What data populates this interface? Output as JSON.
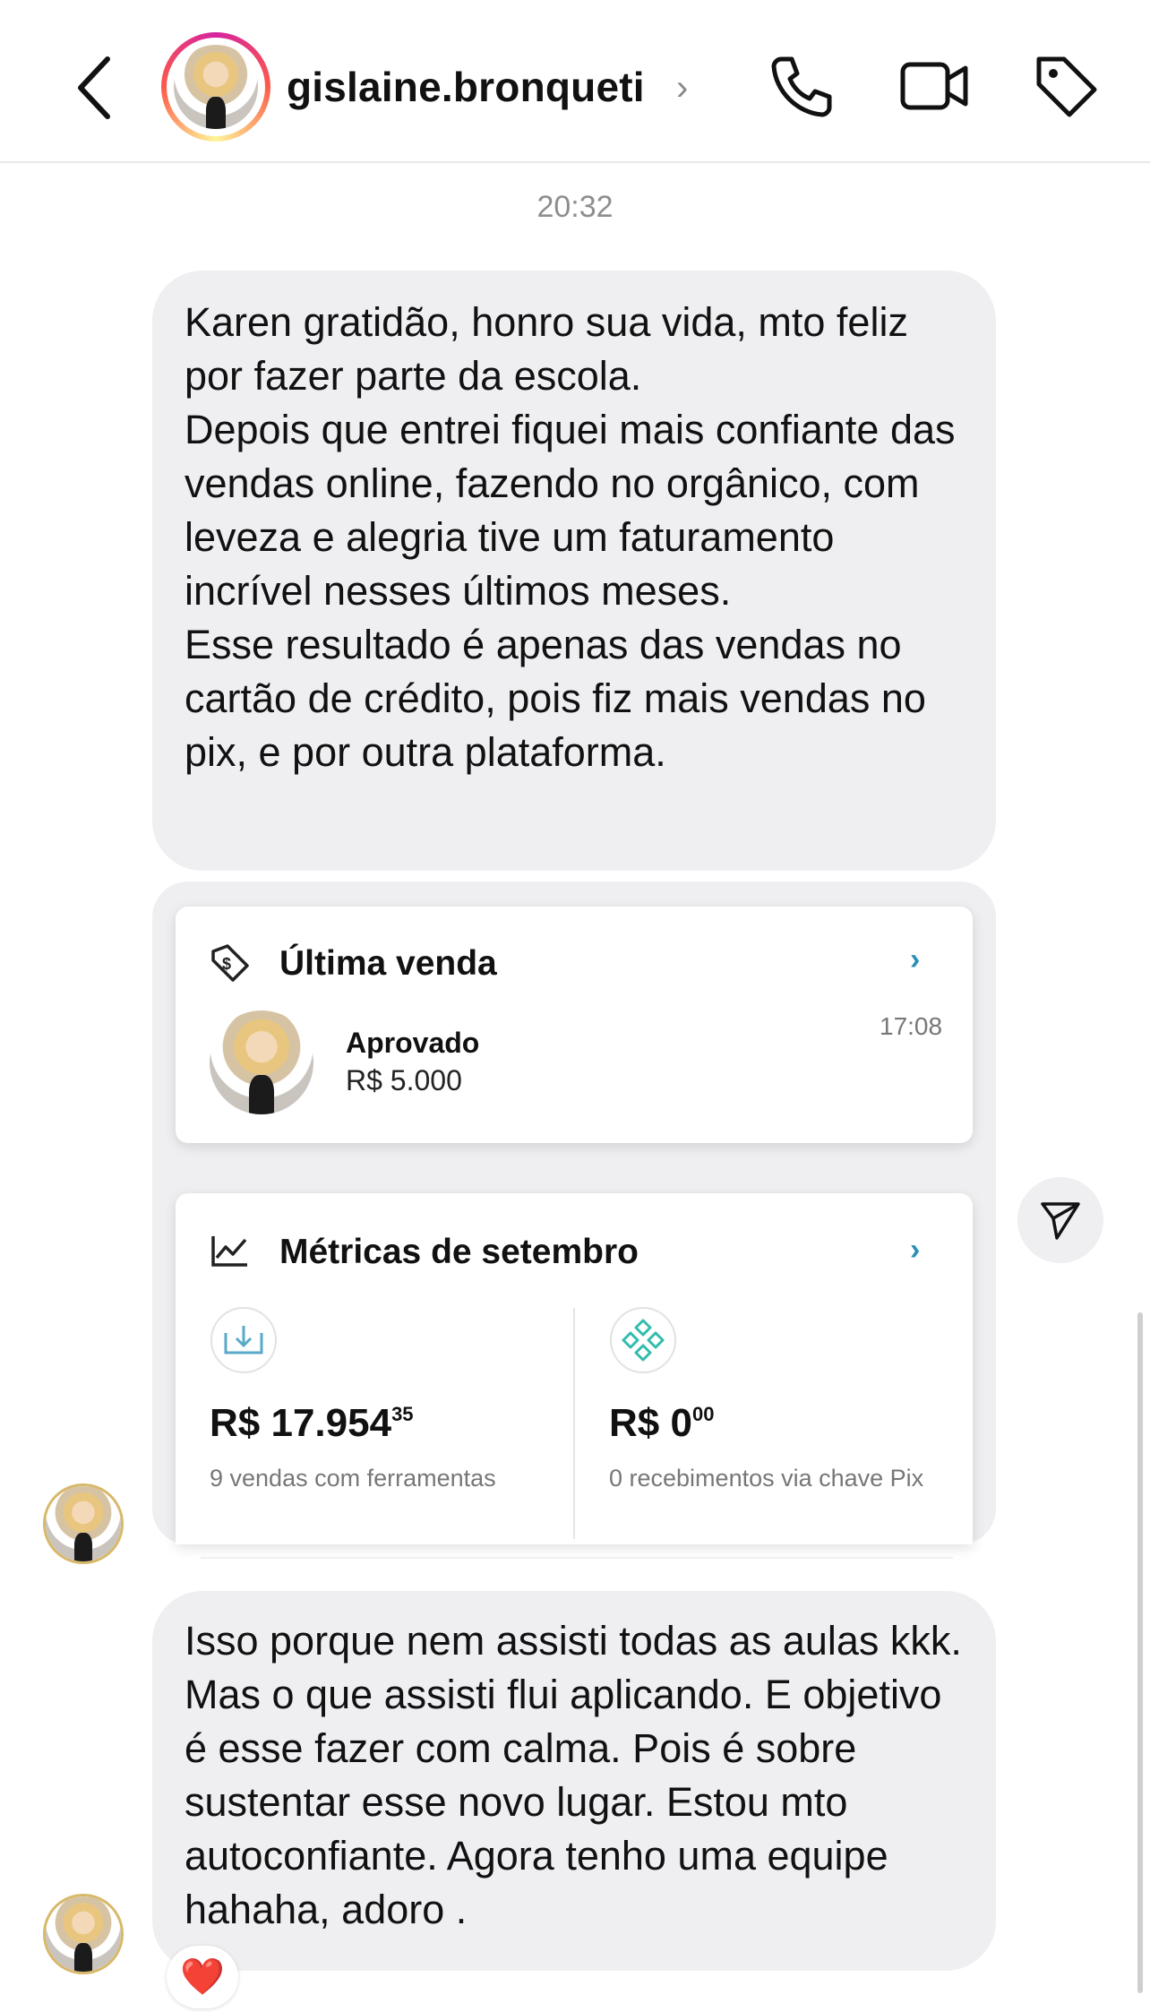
{
  "header": {
    "username": "gislaine.bronqueti",
    "chevron": "›"
  },
  "messages": {
    "timestamp": "20:32",
    "first": [
      "Karen gratidão, honro sua vida, mto feliz por fazer parte da escola.",
      "Depois que entrei fiquei mais confiante das vendas online, fazendo no orgânico, com leveza e alegria tive um faturamento incrível nesses últimos meses.",
      "Esse resultado é apenas das vendas no cartão de crédito, pois fiz mais vendas no pix, e por outra plataforma."
    ],
    "last": "Isso porque nem assisti todas as aulas kkk. Mas o que assisti flui aplicando. E objetivo é esse fazer com calma. Pois é sobre sustentar esse novo lugar. Estou mto autoconfiante. Agora tenho uma equipe hahaha, adoro .",
    "reaction": "❤️"
  },
  "sale_card": {
    "title": "Última venda",
    "status": "Aprovado",
    "amount": "R$ 5.000",
    "time": "17:08",
    "chevron": "›"
  },
  "metrics_card": {
    "title": "Métricas de setembro",
    "chevron": "›",
    "left": {
      "main": "R$ 17.954",
      "cents": "35",
      "caption": "9 vendas com ferramentas"
    },
    "right": {
      "main": "R$ 0",
      "cents": "00",
      "caption": "0 recebimentos via chave Pix"
    }
  },
  "icons": [
    "back-chevron-icon",
    "phone-icon",
    "video-camera-icon",
    "tag-icon",
    "money-tag-icon",
    "chart-line-icon",
    "download-tray-icon",
    "pix-icon",
    "send-icon",
    "heart-icon"
  ],
  "colors": {
    "bubble": "#efeff2",
    "link_chevron": "#2a8fb8",
    "pix": "#32bcad"
  }
}
